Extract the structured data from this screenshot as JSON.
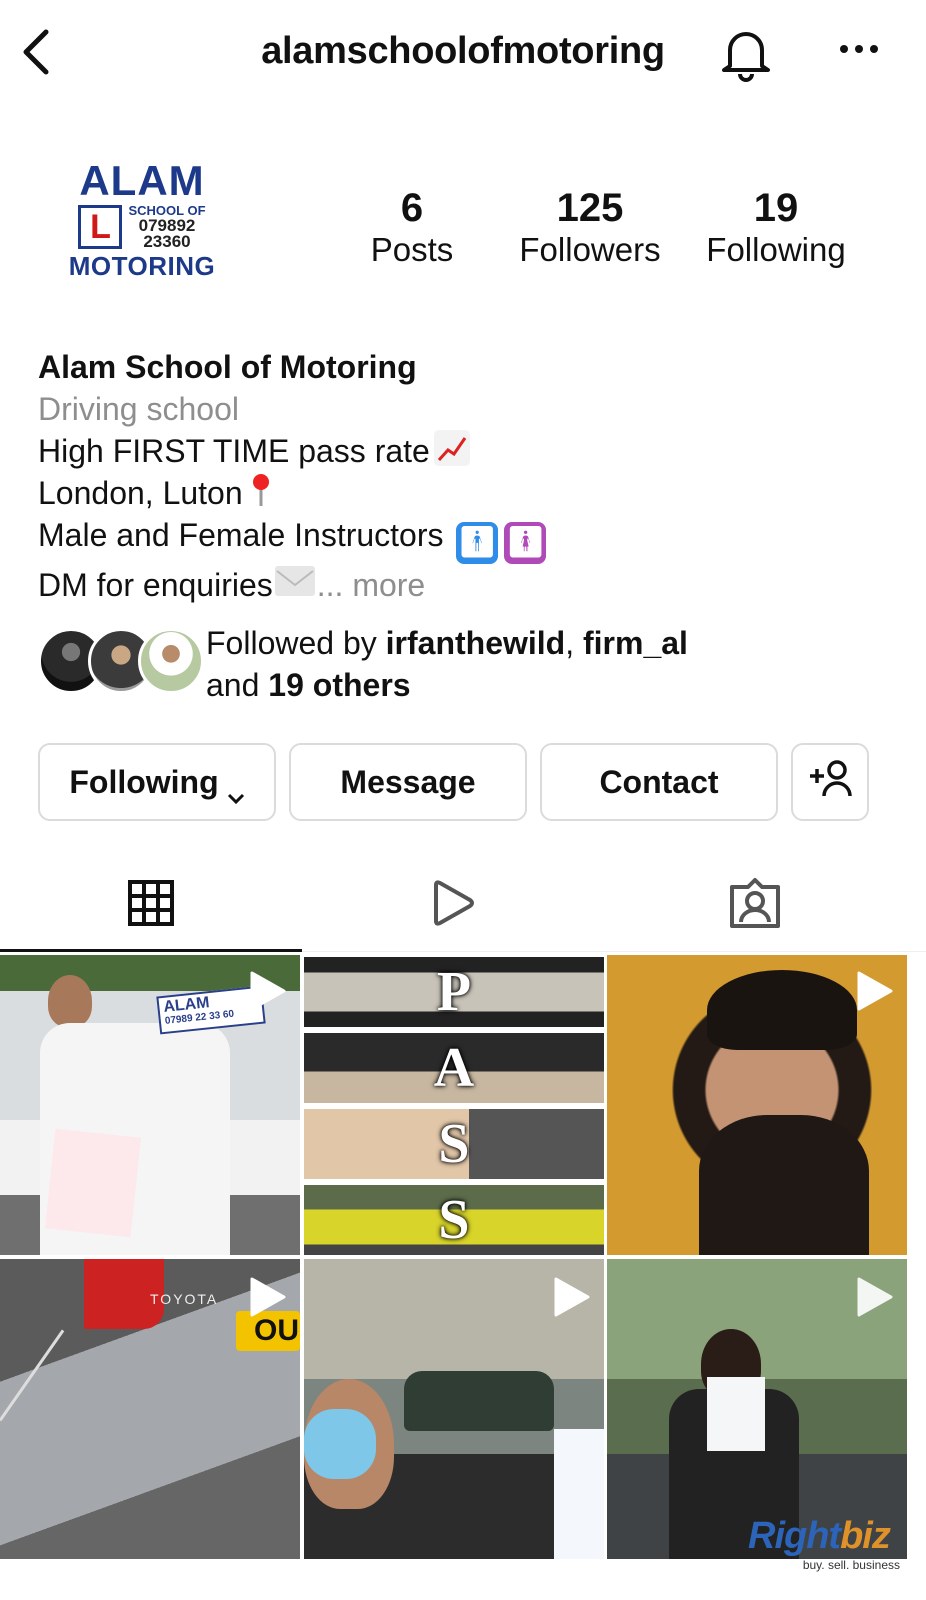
{
  "header": {
    "username": "alamschoolofmotoring"
  },
  "profile": {
    "logo": {
      "top": "ALAM",
      "school_of": "SCHOOL OF",
      "phone_line1": "079892",
      "phone_line2": "23360",
      "bottom": "MOTORING",
      "plate_letter": "L"
    },
    "stats": [
      {
        "value": "6",
        "label": "Posts"
      },
      {
        "value": "125",
        "label": "Followers"
      },
      {
        "value": "19",
        "label": "Following"
      }
    ],
    "name": "Alam School of Motoring",
    "category": "Driving school",
    "bio_lines": [
      "High FIRST TIME pass rate",
      "London, Luton",
      "Male and Female Instructors",
      "DM for enquiries"
    ],
    "more_label": "... more",
    "followed_by": {
      "prefix": "Followed by ",
      "user1": "irfanthewild",
      "separator": ", ",
      "user2": "firm_al",
      "and": "and ",
      "others": "19 others"
    }
  },
  "buttons": {
    "following": "Following",
    "message": "Message",
    "contact": "Contact"
  },
  "tabs": [
    "grid-icon",
    "reels-icon",
    "tagged-icon"
  ],
  "posts": {
    "tile1_sign_line1": "ALAM",
    "tile1_sign_line2": "07989 22 33 60",
    "tile2_letters": [
      "P",
      "A",
      "S",
      "S"
    ],
    "tile4_brand": "TOYOTA",
    "tile4_plate": "OU"
  },
  "watermark": {
    "right": "Right",
    "biz": "biz",
    "tagline": "buy. sell. business"
  },
  "colors": {
    "logo_blue": "#1d3a8a",
    "plate_red": "#d01818",
    "muted_text": "#8e8e8e",
    "border": "#dbdbdb"
  }
}
